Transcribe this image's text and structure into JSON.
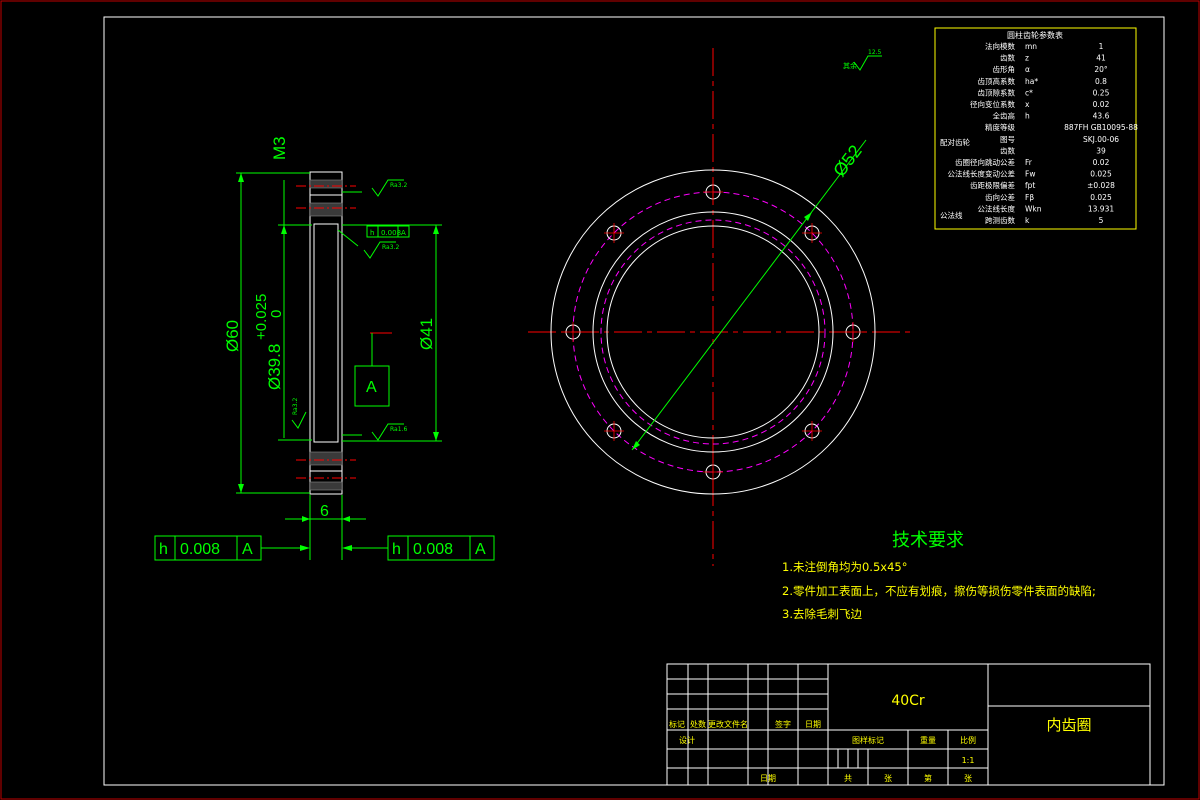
{
  "colors": {
    "background": "#000000",
    "frame": "#ffffff",
    "border_red": "#c00000",
    "dimension": "#00ff00",
    "centerline": "#ff0000",
    "pitch_circle": "#ff00ff",
    "table_text": "#ffffff",
    "table_border": "#ffff00",
    "notes": "#ffff00"
  },
  "section_view": {
    "thread_label": "M3",
    "dim_outer": "Ø60",
    "dim_bore": "Ø39.8",
    "tol_upper": "+0.025",
    "tol_lower": "0",
    "dim_pitch": "Ø41",
    "dim_width": "6",
    "datum": "A",
    "surface_marks": [
      "Ra3.2",
      "Ra3.2",
      "Ra1.6",
      "Ra3.2"
    ],
    "small_fcf": [
      "h",
      "0.008",
      "A"
    ]
  },
  "fcf_left": [
    "h",
    "0.008",
    "A"
  ],
  "fcf_right": [
    "h",
    "0.008",
    "A"
  ],
  "front_view": {
    "dim_label": "Ø52",
    "roughness_default": "12.5",
    "roughness_note": "其余"
  },
  "gear_table": {
    "title": "圆柱齿轮参数表",
    "rows": [
      {
        "name": "法向模数",
        "symbol": "mn",
        "value": "1"
      },
      {
        "name": "齿数",
        "symbol": "z",
        "value": "41"
      },
      {
        "name": "齿形角",
        "symbol": "α",
        "value": "20°"
      },
      {
        "name": "齿顶高系数",
        "symbol": "ha*",
        "value": "0.8"
      },
      {
        "name": "齿顶隙系数",
        "symbol": "c*",
        "value": "0.25"
      },
      {
        "name": "径向变位系数",
        "symbol": "x",
        "value": "0.02"
      },
      {
        "name": "全齿高",
        "symbol": "h",
        "value": "43.6"
      },
      {
        "name": "精度等级",
        "symbol": "",
        "value": "887FH GB10095-88"
      },
      {
        "name": "图号",
        "symbol": "",
        "value": "SKJ.00-06"
      },
      {
        "name": "齿数",
        "symbol": "",
        "value": "39"
      },
      {
        "name": "齿圈径向跳动公差",
        "symbol": "Fr",
        "value": "0.02"
      },
      {
        "name": "公法线长度变动公差",
        "symbol": "Fw",
        "value": "0.025"
      },
      {
        "name": "齿距极限偏差",
        "symbol": "fpt",
        "value": "±0.028"
      },
      {
        "name": "齿向公差",
        "symbol": "Fβ",
        "value": "0.025"
      },
      {
        "name": "公法线长度",
        "symbol": "Wkn",
        "value": "13.931"
      },
      {
        "name": "跨测齿数",
        "symbol": "k",
        "value": "5"
      }
    ],
    "group_pair": "配对齿轮",
    "group_normal": "公法线"
  },
  "notes": {
    "title": "技术要求",
    "items": [
      "1.未注倒角均为0.5x45°",
      "2.零件加工表面上，不应有划痕，擦伤等损伤零件表面的缺陷;",
      "3.去除毛刺飞边"
    ]
  },
  "title_block": {
    "material": "40Cr",
    "part_name": "内齿圈",
    "scale": "1:1",
    "header_cells": [
      "标记",
      "处数",
      "更改文件名",
      "签字",
      "日期"
    ],
    "design": "设计",
    "date": "日期",
    "stage_headers": [
      "图样标记",
      "重量",
      "比例"
    ],
    "sheet_labels": [
      "共",
      "张",
      "第",
      "张"
    ]
  }
}
